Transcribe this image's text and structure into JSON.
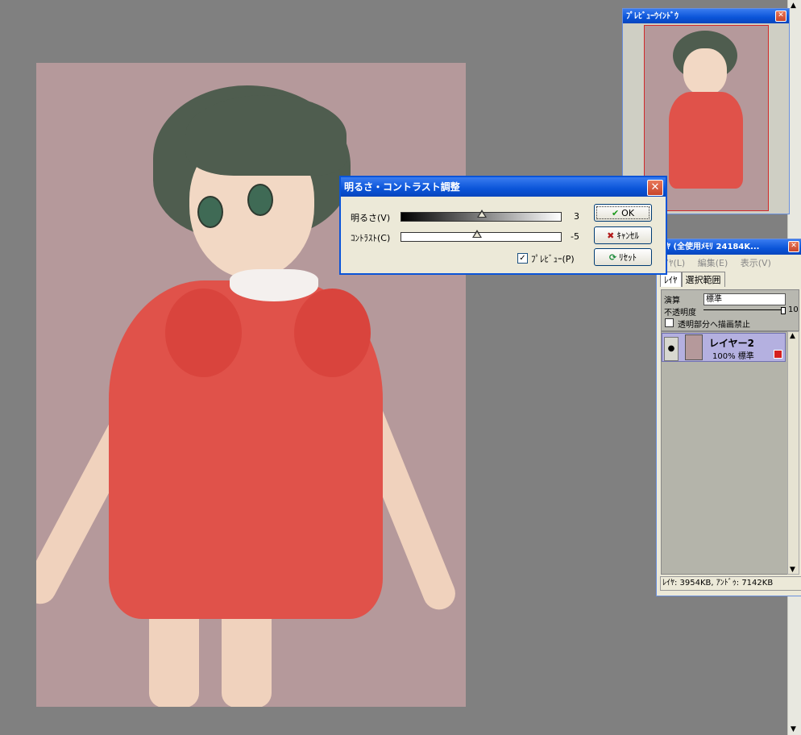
{
  "canvas": {},
  "preview_window": {
    "title": "ﾌﾟﾚﾋﾞｭｰｳｲﾝﾄﾞｳ",
    "close_glyph": "✕"
  },
  "layer_window": {
    "title": "ﾚｲﾔ (全使用ﾒﾓﾘ 24184K...",
    "close_glyph": "✕",
    "menu": [
      "ﾚｲﾔ(L)",
      "編集(E)",
      "表示(V)"
    ],
    "tabs": [
      "ﾚｲﾔ",
      "選択範囲"
    ],
    "blend_label": "演算",
    "blend_value": "標準",
    "opacity_label": "不透明度",
    "opacity_value": "10",
    "lock_label": "透明部分へ描画禁止",
    "layer": {
      "name": "レイヤー2",
      "detail": "100% 標準"
    },
    "status": "ﾚｲﾔ: 3954KB, ｱﾝﾄﾞｩ: 7142KB"
  },
  "dialog": {
    "title": "明るさ・コントラスト調整",
    "close_glyph": "✕",
    "brightness_label": "明るさ(V)",
    "brightness_value": "3",
    "contrast_label": "ｺﾝﾄﾗｽﾄ(C)",
    "contrast_value": "-5",
    "preview_label": "ﾌﾟﾚﾋﾞｭｰ(P)",
    "preview_checked": true,
    "ok_label": "OK",
    "cancel_label": "ｷｬﾝｾﾙ",
    "reset_label": "ﾘｾｯﾄ"
  },
  "icons": {
    "ok": "check-icon",
    "cancel": "x-icon",
    "reset": "refresh-icon",
    "eye": "eye-icon"
  },
  "colors": {
    "accent": "#0a54d8",
    "canvas_bg": "#b5999b",
    "dress": "#e0524a"
  }
}
